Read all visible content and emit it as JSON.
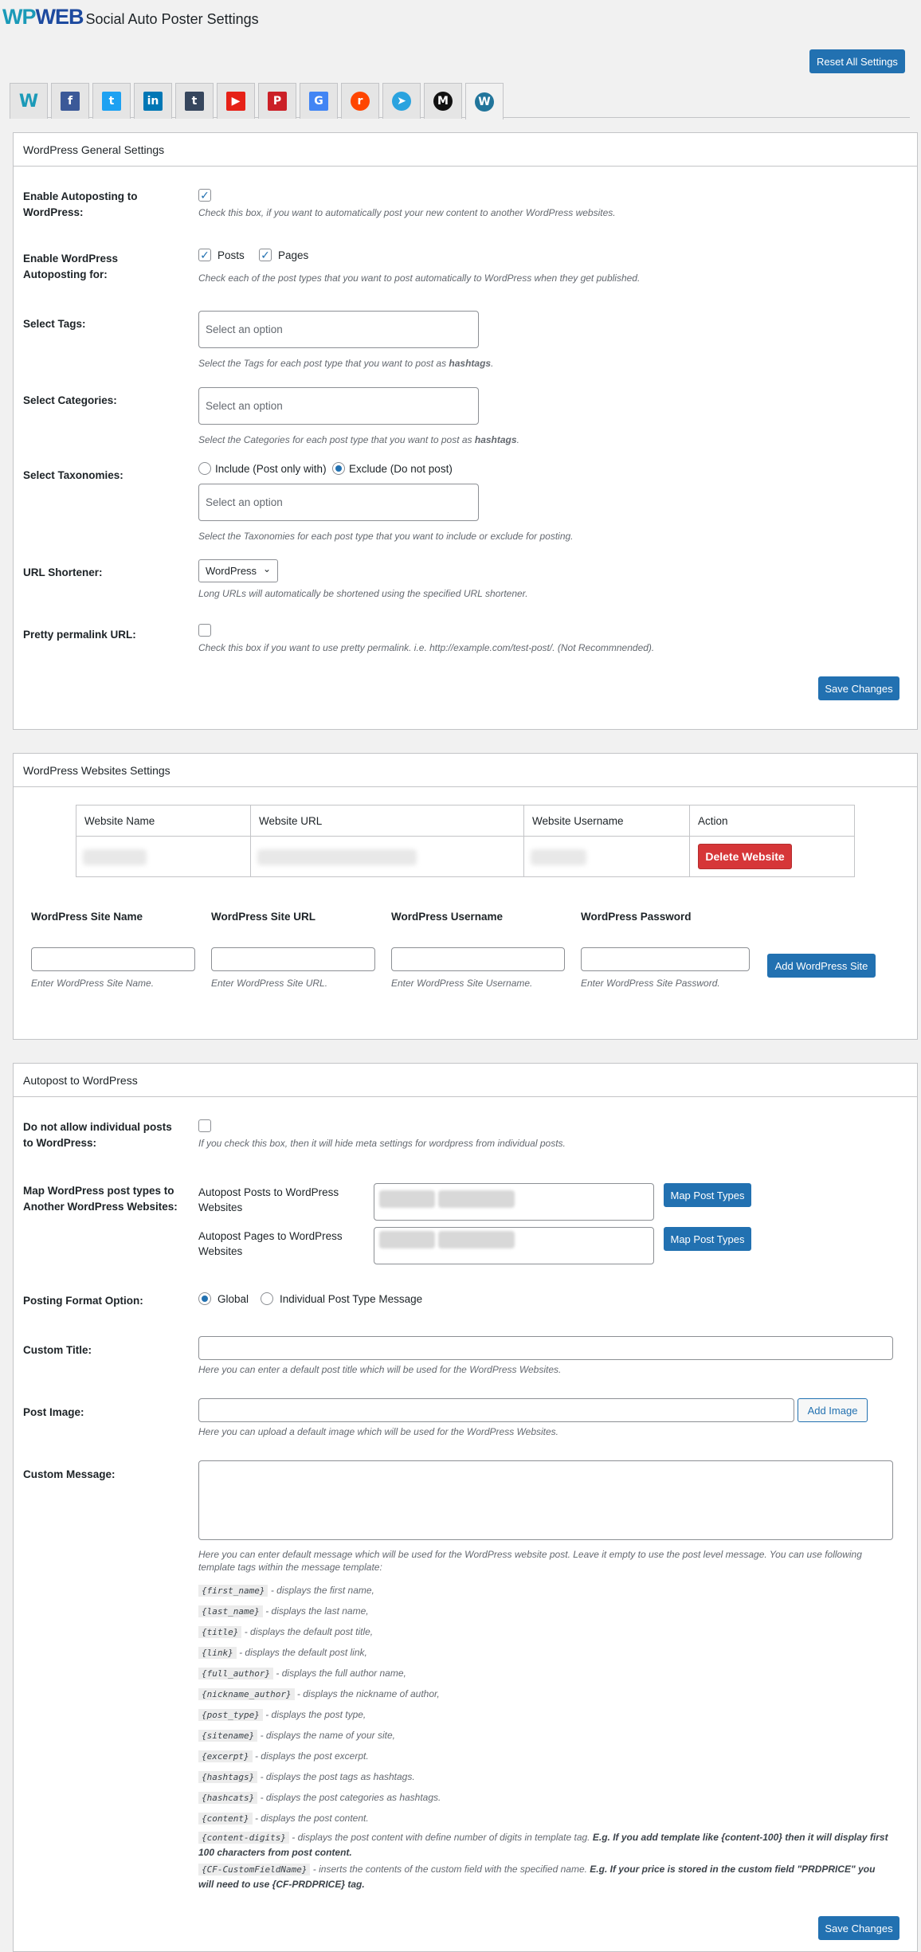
{
  "header": {
    "logo_wp": "WP",
    "logo_web": "WEB",
    "title": "Social Auto Poster Settings",
    "reset_button": "Reset All Settings"
  },
  "tabs": [
    {
      "icon": "wpweb-icon",
      "glyph": "W",
      "color": "#1b9ab8"
    },
    {
      "icon": "facebook-icon",
      "glyph": "f",
      "color": "#3b5998"
    },
    {
      "icon": "twitter-icon",
      "glyph": "t",
      "color": "#1da1f2"
    },
    {
      "icon": "linkedin-icon",
      "glyph": "in",
      "color": "#0077b5"
    },
    {
      "icon": "tumblr-icon",
      "glyph": "t",
      "color": "#36465d"
    },
    {
      "icon": "youtube-icon",
      "glyph": "▶",
      "color": "#e62117"
    },
    {
      "icon": "pinterest-icon",
      "glyph": "P",
      "color": "#cb2027"
    },
    {
      "icon": "google-business-icon",
      "glyph": "G",
      "color": "#4285f4"
    },
    {
      "icon": "reddit-icon",
      "glyph": "r",
      "color": "#ff4500"
    },
    {
      "icon": "telegram-icon",
      "glyph": "➤",
      "color": "#2aa3df"
    },
    {
      "icon": "medium-icon",
      "glyph": "M",
      "color": "#111111"
    },
    {
      "icon": "wordpress-icon",
      "glyph": "W",
      "color": "#21759b"
    }
  ],
  "general": {
    "heading": "WordPress General Settings",
    "enable_label": "Enable Autoposting to WordPress:",
    "enable_desc": "Check this box, if you want to automatically post your new content to another WordPress websites.",
    "types_label": "Enable WordPress Autoposting for:",
    "type_posts": "Posts",
    "type_pages": "Pages",
    "types_desc": "Check each of the post types that you want to post automatically to WordPress when they get published.",
    "tags_label": "Select Tags:",
    "tags_placeholder": "Select an option",
    "tags_desc_pre": "Select the Tags for each post type that you want to post as ",
    "tags_desc_bold": "hashtags",
    "cats_label": "Select Categories:",
    "cats_placeholder": "Select an option",
    "cats_desc_pre": "Select the Categories for each post type that you want to post as ",
    "cats_desc_bold": "hashtags",
    "tax_label": "Select Taxonomies:",
    "tax_include": "Include (Post only with)",
    "tax_exclude": "Exclude (Do not post)",
    "tax_placeholder": "Select an option",
    "tax_desc": "Select the Taxonomies for each post type that you want to include or exclude for posting.",
    "shortener_label": "URL Shortener:",
    "shortener_value": "WordPress",
    "shortener_desc": "Long URLs will automatically be shortened using the specified URL shortener.",
    "pretty_label": "Pretty permalink URL:",
    "pretty_desc": "Check this box if you want to use pretty permalink. i.e. http://example.com/test-post/. (Not Recommnended).",
    "save_button": "Save Changes"
  },
  "websites": {
    "heading": "WordPress Websites Settings",
    "columns": [
      "Website Name",
      "Website URL",
      "Website Username",
      "Action"
    ],
    "delete_button": "Delete Website",
    "form_labels": [
      "WordPress Site Name",
      "WordPress Site URL",
      "WordPress Username",
      "WordPress Password"
    ],
    "form_hints": [
      "Enter WordPress Site Name.",
      "Enter WordPress Site URL.",
      "Enter WordPress Site Username.",
      "Enter WordPress Site Password."
    ],
    "add_button": "Add WordPress Site"
  },
  "autopost": {
    "heading": "Autopost to WordPress",
    "noallow_label": "Do not allow individual posts to WordPress:",
    "noallow_desc": "If you check this box, then it will hide meta settings for wordpress from individual posts.",
    "map_label": "Map WordPress post types to Another WordPress Websites:",
    "map_posts_label": "Autopost Posts to WordPress Websites",
    "map_pages_label": "Autopost Pages to WordPress Websites",
    "map_button": "Map Post Types",
    "format_label": "Posting Format Option:",
    "format_global": "Global",
    "format_individual": "Individual Post Type Message",
    "title_label": "Custom Title:",
    "title_desc": "Here you can enter a default post title which will be used for the WordPress Websites.",
    "image_label": "Post Image:",
    "image_button": "Add Image",
    "image_desc": "Here you can upload a default image which will be used for the WordPress Websites.",
    "message_label": "Custom Message:",
    "message_desc": "Here you can enter default message which will be used for the WordPress website post. Leave it empty to use the post level message. You can use following template tags within the message template:",
    "tags": [
      {
        "tag": "{first_name}",
        "text": " - displays the first name,"
      },
      {
        "tag": "{last_name}",
        "text": " - displays the last name,"
      },
      {
        "tag": "{title}",
        "text": " - displays the default post title,"
      },
      {
        "tag": "{link}",
        "text": " - displays the default post link,"
      },
      {
        "tag": "{full_author}",
        "text": " - displays the full author name,"
      },
      {
        "tag": "{nickname_author}",
        "text": " - displays the nickname of author,"
      },
      {
        "tag": "{post_type}",
        "text": " - displays the post type,"
      },
      {
        "tag": "{sitename}",
        "text": " - displays the name of your site,"
      },
      {
        "tag": "{excerpt}",
        "text": " - displays the post excerpt."
      },
      {
        "tag": "{hashtags}",
        "text": " - displays the post tags as hashtags."
      },
      {
        "tag": "{hashcats}",
        "text": " - displays the post categories as hashtags."
      },
      {
        "tag": "{content}",
        "text": " - displays the post content."
      }
    ],
    "tag_digits": "{content-digits}",
    "tag_digits_text": " - displays the post content with define number of digits in template tag. ",
    "tag_digits_bold": "E.g. If you add template like {content-100} then it will display first 100 characters from post content.",
    "tag_cf": "{CF-CustomFieldName}",
    "tag_cf_text": " - inserts the contents of the custom field with the specified name. ",
    "tag_cf_bold": "E.g. If your price is stored in the custom field \"PRDPRICE\" you will need to use {CF-PRDPRICE} tag.",
    "save_button": "Save Changes"
  }
}
